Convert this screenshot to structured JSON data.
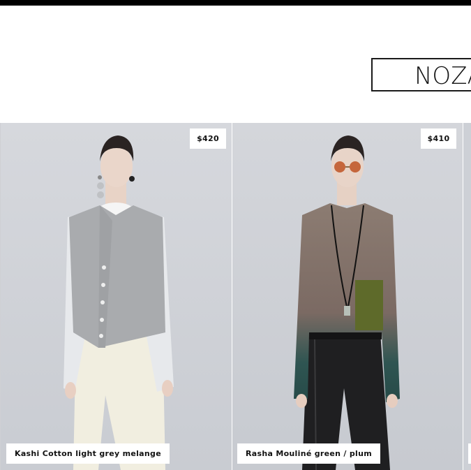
{
  "brand": {
    "name": "NOZA"
  },
  "products": [
    {
      "name": "Kashi Cotton light grey melange",
      "price": "$420"
    },
    {
      "name": "Rasha Mouliné green / plum",
      "price": "$410"
    }
  ],
  "colors": {
    "top_bar": "#000000",
    "tag_bg": "#ffffff",
    "photo_bg": "#d0d3d8"
  }
}
